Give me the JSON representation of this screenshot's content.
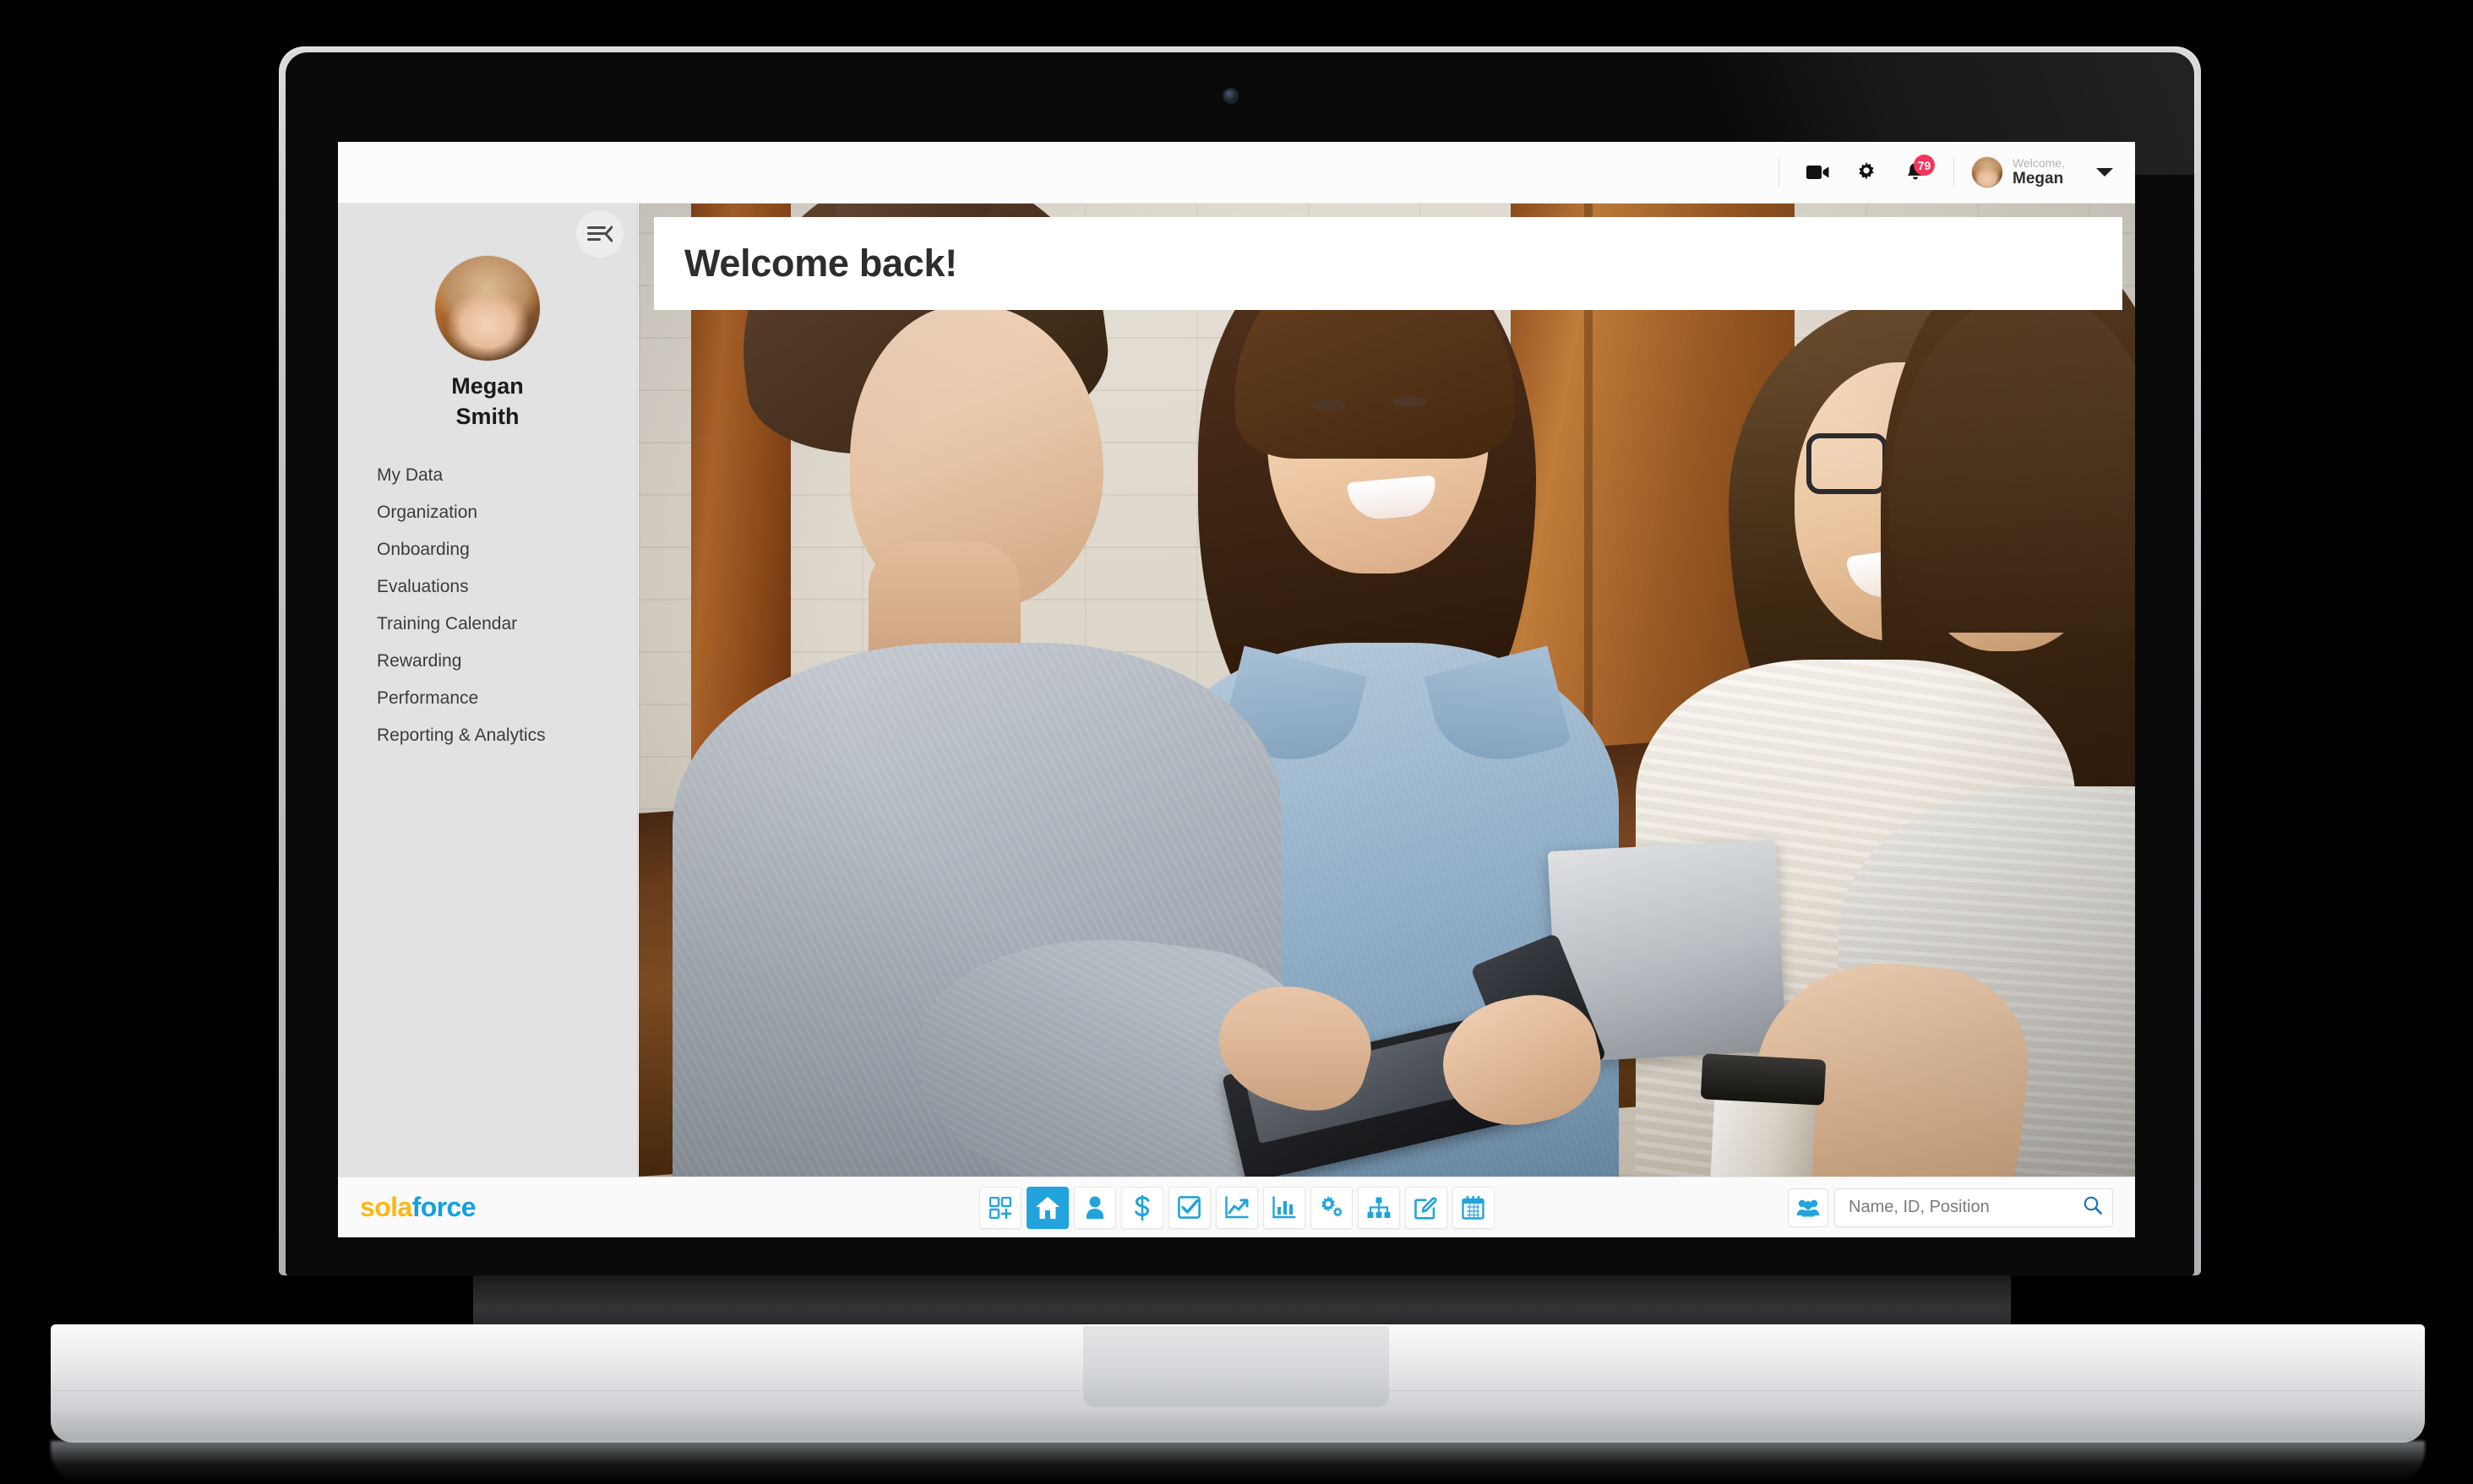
{
  "app": {
    "logo_sola": "sola",
    "logo_force": "force"
  },
  "topbar": {
    "video_icon": "video-camera-icon",
    "settings_icon": "gear-icon",
    "notifications_icon": "bell-icon",
    "notifications_count": "79",
    "welcome_label": "Welcome,",
    "user_name": "Megan",
    "dropdown_icon": "chevron-down-icon",
    "avatar": "user-avatar"
  },
  "sidebar": {
    "collapse_icon": "menu-collapse-icon",
    "profile": {
      "first_name": "Megan",
      "last_name": "Smith",
      "avatar": "user-avatar"
    },
    "items": [
      {
        "label": "My Data"
      },
      {
        "label": "Organization"
      },
      {
        "label": "Onboarding"
      },
      {
        "label": "Evaluations"
      },
      {
        "label": "Training Calendar"
      },
      {
        "label": "Rewarding"
      },
      {
        "label": "Performance"
      },
      {
        "label": "Reporting & Analytics"
      }
    ]
  },
  "main": {
    "welcome_title": "Welcome back!",
    "hero_alt": "four colleagues smiling around a wooden table with a tablet, laptop and coffee"
  },
  "footer": {
    "tools": [
      {
        "name": "apps-grid-add-icon",
        "active": false
      },
      {
        "name": "home-icon",
        "active": true
      },
      {
        "name": "person-icon",
        "active": false
      },
      {
        "name": "dollar-icon",
        "active": false
      },
      {
        "name": "checkbox-icon",
        "active": false
      },
      {
        "name": "line-chart-icon",
        "active": false
      },
      {
        "name": "bar-chart-icon",
        "active": false
      },
      {
        "name": "gears-icon",
        "active": false
      },
      {
        "name": "org-chart-icon",
        "active": false
      },
      {
        "name": "edit-pencil-icon",
        "active": false
      },
      {
        "name": "calendar-icon",
        "active": false
      }
    ],
    "group_icon": "users-group-icon",
    "search_placeholder": "Name, ID, Position",
    "search_value": "",
    "search_icon": "magnifier-icon"
  },
  "colors": {
    "accent_blue": "#22A3DB",
    "logo_yellow": "#FDB813",
    "badge_red": "#f5365c",
    "sidebar_bg": "#e2e2e2"
  }
}
